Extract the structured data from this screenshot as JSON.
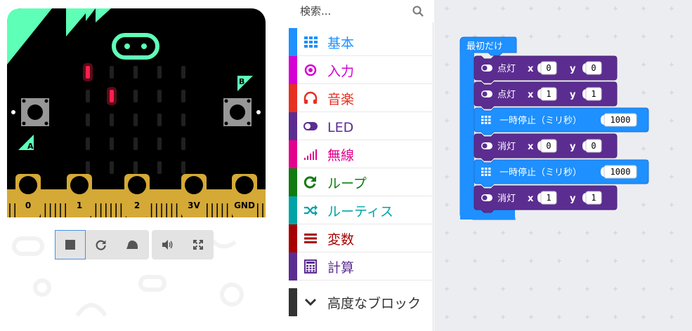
{
  "simulator": {
    "pins": [
      "0",
      "1",
      "2",
      "3V",
      "GND"
    ],
    "button_a": "A",
    "button_b": "B",
    "led_on": [
      [
        0,
        0
      ],
      [
        1,
        1
      ]
    ],
    "controls": [
      {
        "name": "stop-button",
        "icon": "stop-icon",
        "active": true
      },
      {
        "name": "restart-button",
        "icon": "restart-icon",
        "active": false
      },
      {
        "name": "slowmo-button",
        "icon": "snail-icon",
        "active": false
      },
      {
        "name": "mute-button",
        "icon": "speaker-icon",
        "active": false
      },
      {
        "name": "fullscreen-button",
        "icon": "fullscreen-icon",
        "active": false
      }
    ],
    "colors": {
      "board": "#000000",
      "accent": "#5effb7",
      "pads": "#d4a936",
      "led_on": "#ff1f4a",
      "led_off": "#202020"
    }
  },
  "toolbox": {
    "search_placeholder": "検索...",
    "categories": [
      {
        "label": "基本",
        "color": "#1e90ff",
        "icon": "grid-icon"
      },
      {
        "label": "入力",
        "color": "#d400d4",
        "icon": "target-icon"
      },
      {
        "label": "音楽",
        "color": "#e63022",
        "icon": "headphones-icon"
      },
      {
        "label": "LED",
        "color": "#5c2d91",
        "icon": "toggle-icon"
      },
      {
        "label": "無線",
        "color": "#e3008c",
        "icon": "signal-icon"
      },
      {
        "label": "ループ",
        "color": "#107c10",
        "icon": "refresh-icon"
      },
      {
        "label": "ルーティス",
        "color": "#00a4a6",
        "icon": "shuffle-icon"
      },
      {
        "label": "変数",
        "color": "#a80000",
        "icon": "lines-icon"
      },
      {
        "label": "計算",
        "color": "#5c2d91",
        "icon": "calculator-icon"
      }
    ],
    "advanced_label": "高度なブロック"
  },
  "workspace": {
    "on_start_label": "最初だけ",
    "blocks": [
      {
        "label": "点灯",
        "kind": "led",
        "x": "0",
        "y": "0"
      },
      {
        "label": "点灯",
        "kind": "led",
        "x": "1",
        "y": "1"
      },
      {
        "label": "一時停止（ミリ秒）",
        "kind": "basic",
        "value": "1000"
      },
      {
        "label": "消灯",
        "kind": "led",
        "x": "0",
        "y": "0"
      },
      {
        "label": "一時停止（ミリ秒）",
        "kind": "basic",
        "value": "1000"
      },
      {
        "label": "消灯",
        "kind": "led",
        "x": "1",
        "y": "1"
      }
    ],
    "param_x": "x",
    "param_y": "y",
    "colors": {
      "event": "#1e90ff",
      "led": "#5c2d91",
      "basic": "#1e90ff",
      "bg": "#ecedf1"
    }
  }
}
